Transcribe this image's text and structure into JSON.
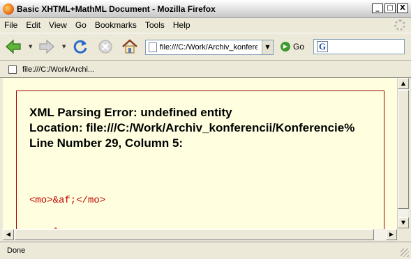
{
  "window": {
    "title": "Basic XHTML+MathML Document - Mozilla Firefox",
    "controls": [
      "_",
      "□",
      "X"
    ]
  },
  "menu": [
    "File",
    "Edit",
    "View",
    "Go",
    "Bookmarks",
    "Tools",
    "Help"
  ],
  "toolbar": {
    "url": "file:///C:/Work/Archiv_konferencii/Konferencie%",
    "go_label": "Go",
    "search_engine": "G",
    "icons": [
      "back-arrow-icon",
      "forward-arrow-icon",
      "reload-icon",
      "stop-icon",
      "home-icon"
    ]
  },
  "tab": {
    "label": "file:///C:/Work/Archi..."
  },
  "content": {
    "error_line1": "XML Parsing Error: undefined entity",
    "error_line2": "Location: file:///C:/Work/Archiv_konferencii/Konferencie%",
    "error_line3": "Line Number 29, Column 5:",
    "source_line": "<mo>&af;</mo>",
    "caret_line": "----^"
  },
  "status": {
    "text": "Done"
  },
  "colors": {
    "page_bg": "#ffffe0",
    "error_border": "#a00000",
    "source_text": "#c00000",
    "chrome": "#ece9d8"
  }
}
